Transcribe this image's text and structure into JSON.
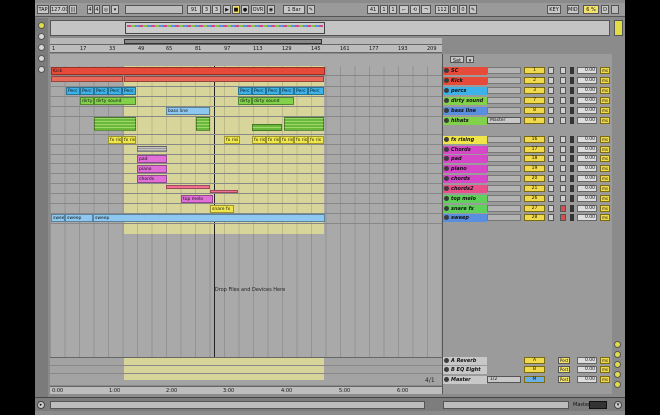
{
  "transport": {
    "tap": "TAP",
    "tempo": "127.00",
    "meter_num": "4",
    "meter_den": "4",
    "pos1": "91",
    "pos2": "3",
    "pos3": "3",
    "ovr": "OVR",
    "quantize": "1 Bar",
    "loop_pos1": "41",
    "loop_pos2": "1",
    "loop_pos3": "1",
    "loop_len1": "112",
    "loop_len2": "0",
    "loop_len3": "0",
    "key": "KEY",
    "midi": "MIDI",
    "cpu": "6 %",
    "d": "D"
  },
  "ruler": {
    "bars": [
      "1",
      "17",
      "33",
      "49",
      "65",
      "81",
      "97",
      "113",
      "129",
      "145",
      "161",
      "177",
      "193",
      "209"
    ],
    "times": [
      "0:00",
      "1:00",
      "2:00",
      "3:00",
      "4:00",
      "5:00",
      "6:00"
    ]
  },
  "clips": {
    "kick": "Kick",
    "perc": "Perc",
    "perc_short": "Perc",
    "dirty": "dirty sound",
    "dirty_short": "dirty",
    "bassline": "bass line",
    "fxris": "fx ris",
    "fxrisi": "fx risi",
    "pad": "pad",
    "piano": "piano",
    "chords": "chords",
    "topmelo": "top melo",
    "snarefx": "snare fx",
    "sweep": "sweep"
  },
  "drop_text": "Drop Files and Devices Here",
  "set_label": "Set",
  "tracks": [
    {
      "name": "SC",
      "color": "#e84a3a",
      "num": "1"
    },
    {
      "name": "Kick",
      "color": "#e84a3a",
      "num": "2"
    },
    {
      "name": "percs",
      "color": "#3db2e8",
      "num": "3"
    },
    {
      "name": "dirty sound",
      "color": "#82d14a",
      "num": "7"
    },
    {
      "name": "bass line",
      "color": "#5a8fe0",
      "num": "8"
    },
    {
      "name": "hihats",
      "color": "#82d14a",
      "num": "9"
    },
    {
      "name": "fx rising",
      "color": "#f0e64a",
      "num": "16"
    },
    {
      "name": "Chords",
      "color": "#d648c8",
      "num": "17"
    },
    {
      "name": "pad",
      "color": "#d648c8",
      "num": "18"
    },
    {
      "name": "piano",
      "color": "#d648c8",
      "num": "19"
    },
    {
      "name": "chords",
      "color": "#d648c8",
      "num": "20"
    },
    {
      "name": "chords2",
      "color": "#e8508a",
      "num": "21"
    },
    {
      "name": "top melo",
      "color": "#5fd15a",
      "num": "26"
    },
    {
      "name": "snare fx",
      "color": "#5fd15a",
      "num": "27"
    },
    {
      "name": "sweep",
      "color": "#5a8fe0",
      "num": "28"
    }
  ],
  "hihat_routing": "Master",
  "volume": "0.00",
  "pan": "ms",
  "returns": [
    {
      "name": "A Reverb",
      "letter": "A"
    },
    {
      "name": "B EQ Eight",
      "letter": "B"
    }
  ],
  "master": {
    "name": "Master",
    "routing": "1/2",
    "letter": "M"
  },
  "post_label": "Post",
  "bottom_bar": {
    "page": "4/1"
  },
  "status": {
    "monitor": "Master"
  }
}
